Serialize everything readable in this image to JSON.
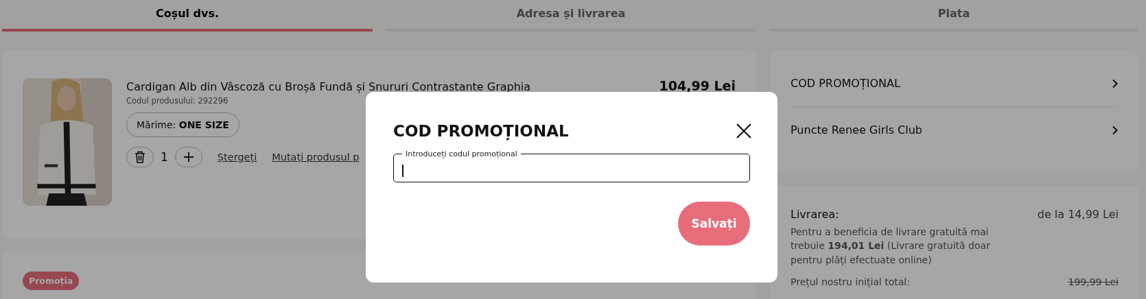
{
  "tabs": [
    {
      "label": "Coșul dvs.",
      "selected": true
    },
    {
      "label": "Adresa și livrarea",
      "selected": false
    },
    {
      "label": "Plata",
      "selected": false
    }
  ],
  "cart_item": {
    "title": "Cardigan Alb din Vâscoză cu Broșă Fundă și Snururi Contrastante Graphia",
    "price": "104,99 Lei",
    "product_code": "Codul produsului: 292296",
    "size": "Mărime: **ONE SIZE**",
    "quantity": "1",
    "delete_link": "Ștergeți",
    "move_link": "Mutați produsul p"
  },
  "promo_badge": "Promoția",
  "summary_links": [
    {
      "label": "COD PROMOȚIONAL"
    },
    {
      "label": "Puncte Renee Girls Club"
    }
  ],
  "delivery": {
    "label": "Livrarea:",
    "price": "de la 14,99 Lei",
    "note": "Pentru a beneficia de livrare gratuită mai trebuie **194,01 Lei** (Livrare gratuită doar pentru plăți efectuate online)",
    "original_total_label": "Prețul nostru inițial total:",
    "original_total_value": "199,99 Lei"
  },
  "modal": {
    "title": "COD PROMOȚIONAL",
    "field_label": "Introduceți codul promoțional",
    "button": "Salvați"
  }
}
